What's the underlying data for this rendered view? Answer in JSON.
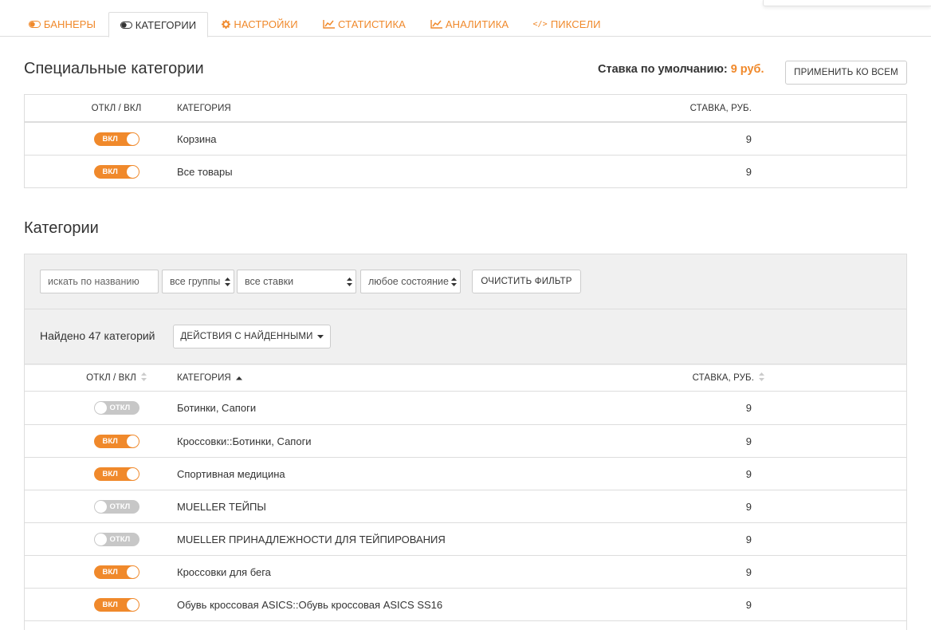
{
  "tabs": [
    {
      "label": "БАННЕРЫ",
      "icon": "toggle-icon",
      "active": false
    },
    {
      "label": "КАТЕГОРИИ",
      "icon": "toggle-icon",
      "active": true
    },
    {
      "label": "НАСТРОЙКИ",
      "icon": "gear-icon",
      "active": false
    },
    {
      "label": "СТАТИСТИКА",
      "icon": "line-chart-icon",
      "active": false
    },
    {
      "label": "АНАЛИТИКА",
      "icon": "line-chart-icon",
      "active": false
    },
    {
      "label": "ПИКСЕЛИ",
      "icon": "code-icon",
      "active": false
    }
  ],
  "colors": {
    "accent": "#f0892b",
    "toggle_off": "#c7c7c7",
    "panel_bg": "#f0f0f0",
    "border": "#dddddd"
  },
  "special": {
    "title": "Специальные категории",
    "default_rate_label": "Ставка по умолчанию:",
    "default_rate_value": "9 руб.",
    "apply_all_label": "ПРИМЕНИТЬ КО ВСЕМ",
    "headers": {
      "toggle": "ОТКЛ / ВКЛ",
      "category": "КАТЕГОРИЯ",
      "rate": "СТАВКА, РУБ."
    },
    "rows": [
      {
        "enabled": true,
        "toggle_label": "ВКЛ",
        "name": "Корзина",
        "rate": "9"
      },
      {
        "enabled": true,
        "toggle_label": "ВКЛ",
        "name": "Все товары",
        "rate": "9"
      }
    ]
  },
  "categories": {
    "title": "Категории",
    "filter": {
      "search_placeholder": "искать по названию",
      "group_select": "все группы",
      "rate_select": "все ставки",
      "state_select": "любое состояние",
      "clear_label": "ОЧИСТИТЬ ФИЛЬТР"
    },
    "found_text": "Найдено 47 категорий",
    "actions_label": "ДЕЙСТВИЯ С НАЙДЕННЫМИ",
    "headers": {
      "toggle": "ОТКЛ / ВКЛ",
      "category": "КАТЕГОРИЯ",
      "rate": "СТАВКА, РУБ."
    },
    "rows": [
      {
        "enabled": false,
        "toggle_label": "ОТКЛ",
        "name": "Ботинки, Сапоги",
        "rate": "9"
      },
      {
        "enabled": true,
        "toggle_label": "ВКЛ",
        "name": "Кроссовки::Ботинки, Сапоги",
        "rate": "9"
      },
      {
        "enabled": true,
        "toggle_label": "ВКЛ",
        "name": "Спортивная медицина",
        "rate": "9"
      },
      {
        "enabled": false,
        "toggle_label": "ОТКЛ",
        "name": "MUELLER ТЕЙПЫ",
        "rate": "9"
      },
      {
        "enabled": false,
        "toggle_label": "ОТКЛ",
        "name": "MUELLER ПРИНАДЛЕЖНОСТИ ДЛЯ ТЕЙПИРОВАНИЯ",
        "rate": "9"
      },
      {
        "enabled": true,
        "toggle_label": "ВКЛ",
        "name": "Кроссовки для бега",
        "rate": "9"
      },
      {
        "enabled": true,
        "toggle_label": "ВКЛ",
        "name": "Обувь кроссовая ASICS::Обувь кроссовая ASICS SS16",
        "rate": "9"
      }
    ]
  }
}
